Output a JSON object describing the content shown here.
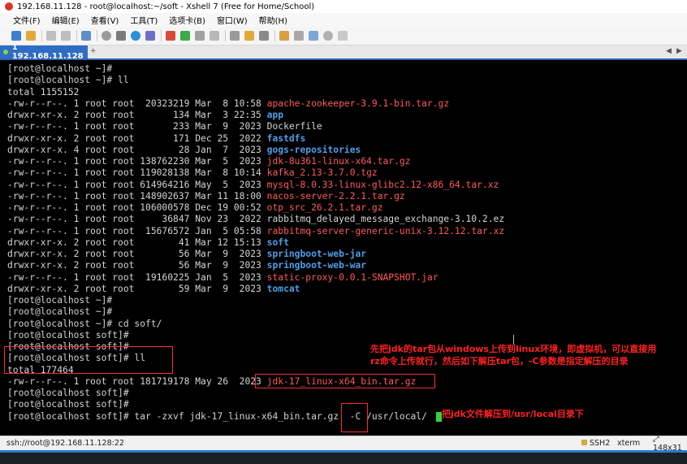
{
  "window": {
    "title": "192.168.11.128 - root@localhost:~/soft - Xshell 7 (Free for Home/School)"
  },
  "menu": [
    "文件(F)",
    "编辑(E)",
    "查看(V)",
    "工具(T)",
    "选项卡(B)",
    "窗口(W)",
    "帮助(H)"
  ],
  "tab": {
    "label": "1 192.168.11.128"
  },
  "terminal": {
    "lines": [
      {
        "segments": [
          {
            "t": "[root@localhost ~]#",
            "c": "white"
          }
        ]
      },
      {
        "segments": [
          {
            "t": "[root@localhost ~]# ll",
            "c": "white"
          }
        ]
      },
      {
        "segments": [
          {
            "t": "total 1155152",
            "c": "white"
          }
        ]
      },
      {
        "segments": [
          {
            "t": "-rw-r--r--. 1 root root  20323219 Mar  8 10:58 ",
            "c": "white"
          },
          {
            "t": "apache-zookeeper-3.9.1-bin.tar.gz",
            "c": "red"
          }
        ]
      },
      {
        "segments": [
          {
            "t": "drwxr-xr-x. 2 root root       134 Mar  3 22:35 ",
            "c": "white"
          },
          {
            "t": "app",
            "c": "blue"
          }
        ]
      },
      {
        "segments": [
          {
            "t": "-rw-r--r--. 1 root root       233 Mar  9  2023 Dockerfile",
            "c": "white"
          }
        ]
      },
      {
        "segments": [
          {
            "t": "drwxr-xr-x. 2 root root       171 Dec 25  2022 ",
            "c": "white"
          },
          {
            "t": "fastdfs",
            "c": "blue"
          }
        ]
      },
      {
        "segments": [
          {
            "t": "drwxr-xr-x. 4 root root        28 Jan  7  2023 ",
            "c": "white"
          },
          {
            "t": "gogs-repositories",
            "c": "blue"
          }
        ]
      },
      {
        "segments": [
          {
            "t": "-rw-r--r--. 1 root root 138762230 Mar  5  2023 ",
            "c": "white"
          },
          {
            "t": "jdk-8u361-linux-x64.tar.gz",
            "c": "red"
          }
        ]
      },
      {
        "segments": [
          {
            "t": "-rw-r--r--. 1 root root 119028138 Mar  8 10:14 ",
            "c": "white"
          },
          {
            "t": "kafka_2.13-3.7.0.tgz",
            "c": "red"
          }
        ]
      },
      {
        "segments": [
          {
            "t": "-rw-r--r--. 1 root root 614964216 May  5  2023 ",
            "c": "white"
          },
          {
            "t": "mysql-8.0.33-linux-glibc2.12-x86_64.tar.xz",
            "c": "red"
          }
        ]
      },
      {
        "segments": [
          {
            "t": "-rw-r--r--. 1 root root 148902637 Mar 11 18:00 ",
            "c": "white"
          },
          {
            "t": "nacos-server-2.2.1.tar.gz",
            "c": "red"
          }
        ]
      },
      {
        "segments": [
          {
            "t": "-rw-r--r--. 1 root root 106000578 Dec 19 00:52 ",
            "c": "white"
          },
          {
            "t": "otp_src_26.2.1.tar.gz",
            "c": "red"
          }
        ]
      },
      {
        "segments": [
          {
            "t": "-rw-r--r--. 1 root root     36847 Nov 23  2022 rabbitmq_delayed_message_exchange-3.10.2.ez",
            "c": "white"
          }
        ]
      },
      {
        "segments": [
          {
            "t": "-rw-r--r--. 1 root root  15676572 Jan  5 05:58 ",
            "c": "white"
          },
          {
            "t": "rabbitmq-server-generic-unix-3.12.12.tar.xz",
            "c": "red"
          }
        ]
      },
      {
        "segments": [
          {
            "t": "drwxr-xr-x. 2 root root        41 Mar 12 15:13 ",
            "c": "white"
          },
          {
            "t": "soft",
            "c": "blue"
          }
        ]
      },
      {
        "segments": [
          {
            "t": "drwxr-xr-x. 2 root root        56 Mar  9  2023 ",
            "c": "white"
          },
          {
            "t": "springboot-web-jar",
            "c": "blue"
          }
        ]
      },
      {
        "segments": [
          {
            "t": "drwxr-xr-x. 2 root root        56 Mar  9  2023 ",
            "c": "white"
          },
          {
            "t": "springboot-web-war",
            "c": "blue"
          }
        ]
      },
      {
        "segments": [
          {
            "t": "-rw-r--r--. 1 root root  19160225 Jan  5  2023 ",
            "c": "white"
          },
          {
            "t": "static-proxy-0.0.1-SNAPSHOT.jar",
            "c": "red"
          }
        ]
      },
      {
        "segments": [
          {
            "t": "drwxr-xr-x. 2 root root        59 Mar  9  2023 ",
            "c": "white"
          },
          {
            "t": "tomcat",
            "c": "blue"
          }
        ]
      },
      {
        "segments": [
          {
            "t": "[root@localhost ~]#",
            "c": "white"
          }
        ]
      },
      {
        "segments": [
          {
            "t": "[root@localhost ~]#",
            "c": "white"
          }
        ]
      },
      {
        "segments": [
          {
            "t": "[root@localhost ~]# cd soft/",
            "c": "white"
          }
        ]
      },
      {
        "segments": [
          {
            "t": "[root@localhost soft]#",
            "c": "white"
          }
        ]
      },
      {
        "segments": [
          {
            "t": "[root@localhost soft]#",
            "c": "white"
          }
        ]
      },
      {
        "segments": [
          {
            "t": "[root@localhost soft]# ll",
            "c": "white"
          }
        ]
      },
      {
        "segments": [
          {
            "t": "total 177464",
            "c": "white"
          }
        ]
      },
      {
        "segments": [
          {
            "t": "-rw-r--r--. 1 root root 181719178 May 26  2023 ",
            "c": "white"
          },
          {
            "t": "jdk-17_linux-x64_bin.tar.gz",
            "c": "red"
          }
        ]
      },
      {
        "segments": [
          {
            "t": "[root@localhost soft]#",
            "c": "white"
          }
        ]
      },
      {
        "segments": [
          {
            "t": "[root@localhost soft]#",
            "c": "white"
          }
        ]
      },
      {
        "segments": [
          {
            "t": "[root@localhost soft]# tar -zxvf jdk-17_linux-x64_bin.tar.gz  -C /usr/local/ ",
            "c": "white"
          }
        ]
      }
    ]
  },
  "annotations": {
    "note1_line1": "先把jdk的tar包从windows上传到linux环境，即虚拟机，可以直接用",
    "note1_line2": "rz命令上传就行，然后如下解压tar包，-C参数是指定解压的目录",
    "note2": "把jdk文件解压到/usr/local目录下"
  },
  "status": {
    "connection": "ssh://root@192.168.11.128:22",
    "protocol": "SSH2",
    "terminal_type": "xterm",
    "size": "148x31"
  },
  "colors": {
    "accent": "#2f6cc4",
    "annotation": "#ff2020",
    "dir": "#4f9ee8",
    "archive": "#ff5a5a"
  }
}
